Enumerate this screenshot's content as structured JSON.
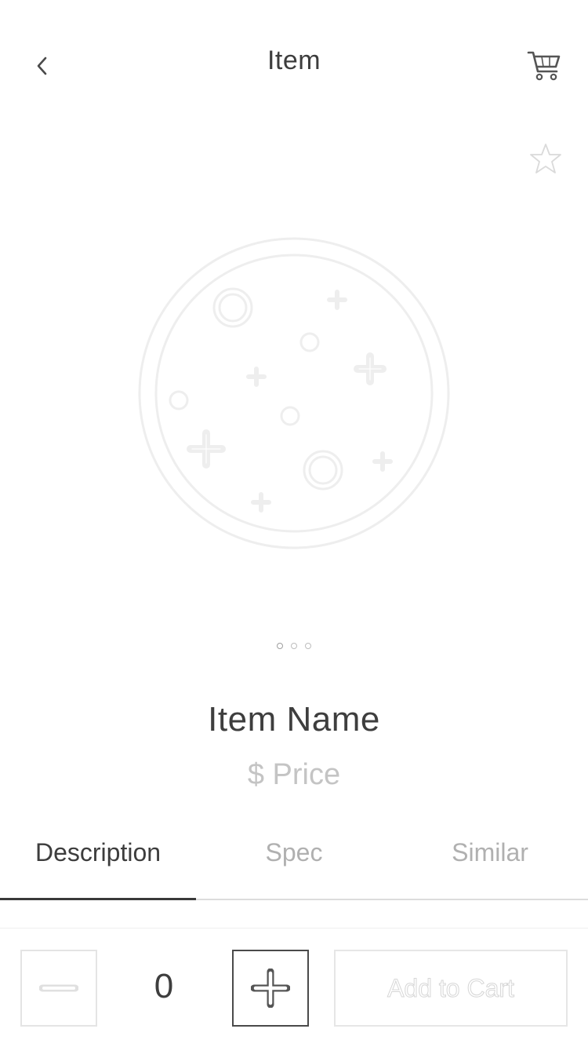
{
  "header": {
    "title": "Item",
    "back_icon": "chevron-left-icon",
    "cart_icon": "cart-icon"
  },
  "favorite": {
    "icon": "star-outline-icon"
  },
  "hero": {
    "image": "planet-placeholder"
  },
  "pager": {
    "count": 3,
    "active_index": 0
  },
  "item": {
    "name": "Item Name",
    "price": "$ Price"
  },
  "tabs": [
    {
      "label": "Description",
      "active": true
    },
    {
      "label": "Spec",
      "active": false
    },
    {
      "label": "Similar",
      "active": false
    }
  ],
  "purchase": {
    "quantity": "0",
    "minus_icon": "minus-icon",
    "plus_icon": "plus-icon",
    "add_to_cart_label": "Add to Cart"
  },
  "colors": {
    "text_primary": "#3d3d3d",
    "text_muted": "#b0b0b0",
    "price": "#c4c4c4",
    "border_light": "#e4e4e4",
    "border_dark": "#4a4a4a"
  }
}
